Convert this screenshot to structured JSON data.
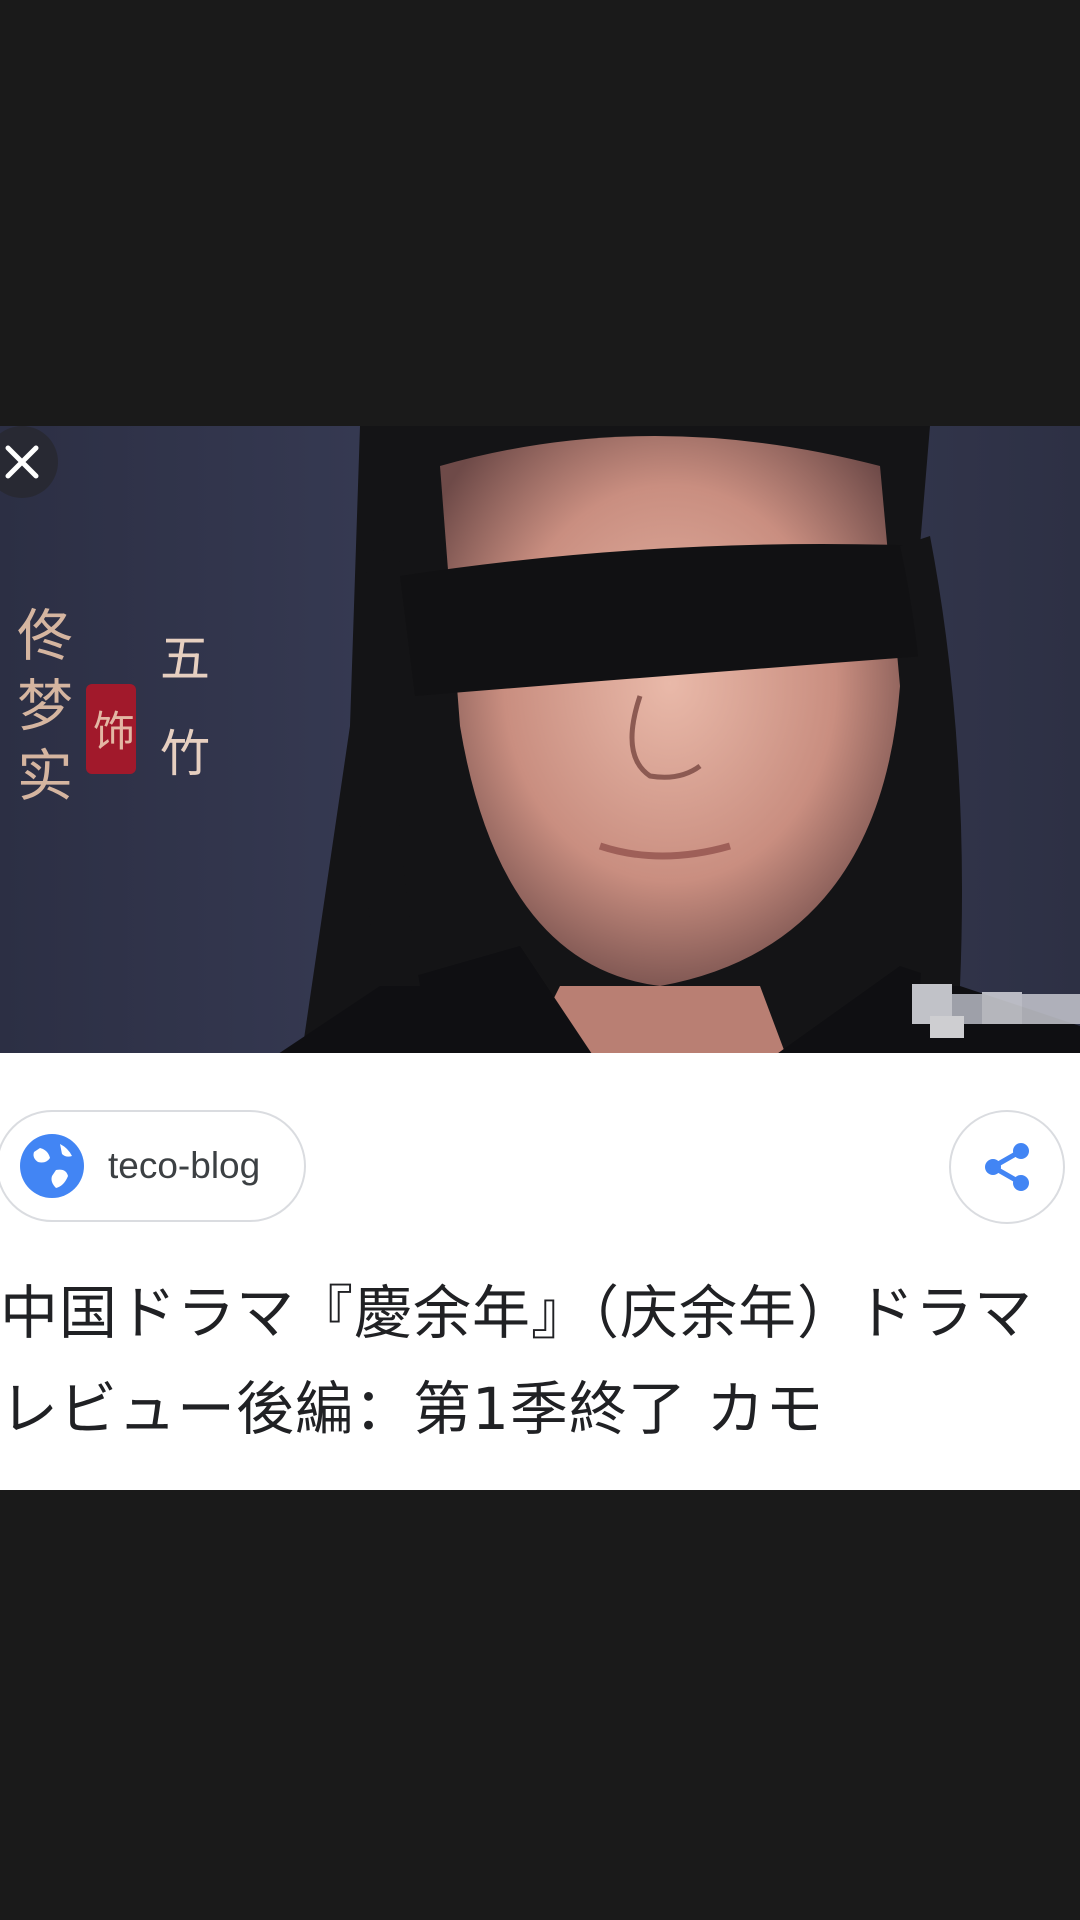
{
  "viewer": {
    "close_icon": "close-icon"
  },
  "image": {
    "overlay_text": {
      "main": "佟梦实",
      "red_seal": "饰",
      "role": "五竹"
    },
    "colors": {
      "background": "#353950",
      "blindfold": "#111111",
      "hair": "#121212",
      "skin": "#d8a596"
    }
  },
  "card": {
    "source": {
      "icon": "globe-icon",
      "label": "teco-blog"
    },
    "share_icon": "share-icon",
    "title": "中国ドラマ『慶余年』（庆余年）ドラマレビュー後編：第1季終了 カモ",
    "accent": "#4285f4"
  }
}
